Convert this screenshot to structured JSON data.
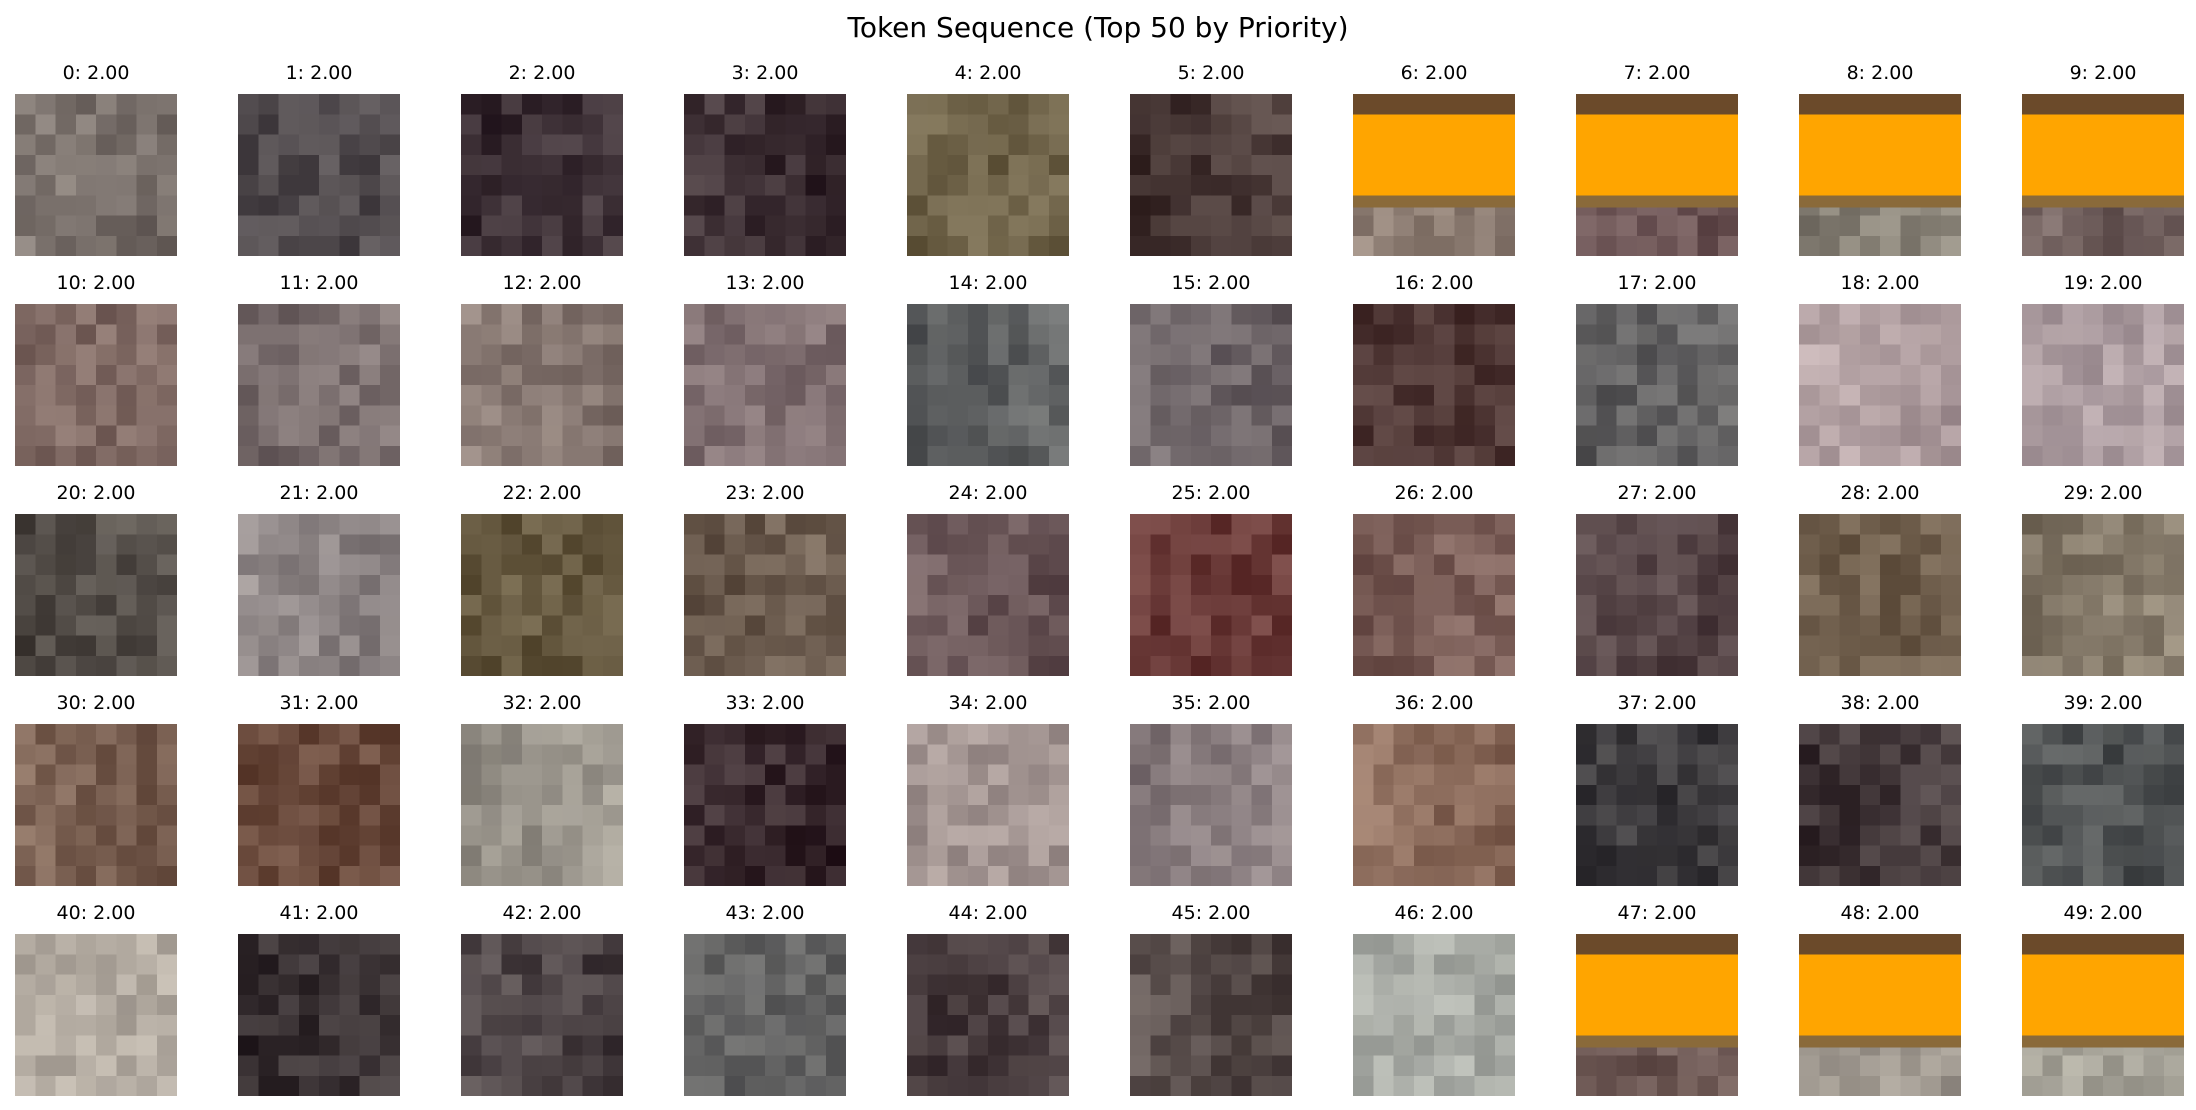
{
  "figure": {
    "title": "Token Sequence (Top 50 by Priority)"
  },
  "colors": {
    "highlight": "#FFA500"
  },
  "tokens": [
    {
      "label": "0: 2.00",
      "tone": "#7a716c",
      "banner": false
    },
    {
      "label": "1: 2.00",
      "tone": "#524c4f",
      "banner": false
    },
    {
      "label": "2: 2.00",
      "tone": "#3d3036",
      "banner": false
    },
    {
      "label": "3: 2.00",
      "tone": "#3d2f34",
      "banner": false
    },
    {
      "label": "4: 2.00",
      "tone": "#6e6248",
      "banner": false
    },
    {
      "label": "5: 2.00",
      "tone": "#4a3a38",
      "banner": false
    },
    {
      "label": "6: 2.00",
      "tone": "#8a7a70",
      "banner": true
    },
    {
      "label": "7: 2.00",
      "tone": "#6d5556",
      "banner": true
    },
    {
      "label": "8: 2.00",
      "tone": "#8a8479",
      "banner": true
    },
    {
      "label": "9: 2.00",
      "tone": "#6e5d5b",
      "banner": true
    },
    {
      "label": "10: 2.00",
      "tone": "#806a64",
      "banner": false
    },
    {
      "label": "11: 2.00",
      "tone": "#7a6e6e",
      "banner": false
    },
    {
      "label": "12: 2.00",
      "tone": "#857670",
      "banner": false
    },
    {
      "label": "13: 2.00",
      "tone": "#806f71",
      "banner": false
    },
    {
      "label": "14: 2.00",
      "tone": "#5d5f60",
      "banner": false
    },
    {
      "label": "15: 2.00",
      "tone": "#6f6669",
      "banner": false
    },
    {
      "label": "16: 2.00",
      "tone": "#4e3634",
      "banner": false
    },
    {
      "label": "17: 2.00",
      "tone": "#636263",
      "banner": false
    },
    {
      "label": "18: 2.00",
      "tone": "#b09ea0",
      "banner": false
    },
    {
      "label": "19: 2.00",
      "tone": "#ae9ea2",
      "banner": false
    },
    {
      "label": "20: 2.00",
      "tone": "#534d48",
      "banner": false
    },
    {
      "label": "21: 2.00",
      "tone": "#8d8585",
      "banner": false
    },
    {
      "label": "22: 2.00",
      "tone": "#65583f",
      "banner": false
    },
    {
      "label": "23: 2.00",
      "tone": "#6c5c4f",
      "banner": false
    },
    {
      "label": "24: 2.00",
      "tone": "#6a5658",
      "banner": false
    },
    {
      "label": "25: 2.00",
      "tone": "#6a3a38",
      "banner": false
    },
    {
      "label": "26: 2.00",
      "tone": "#7a5d57",
      "banner": false
    },
    {
      "label": "27: 2.00",
      "tone": "#574648",
      "banner": false
    },
    {
      "label": "28: 2.00",
      "tone": "#705f4d",
      "banner": false
    },
    {
      "label": "29: 2.00",
      "tone": "#857a6a",
      "banner": false
    },
    {
      "label": "30: 2.00",
      "tone": "#7a6052",
      "banner": false
    },
    {
      "label": "31: 2.00",
      "tone": "#6a4a3c",
      "banner": false
    },
    {
      "label": "32: 2.00",
      "tone": "#9a958c",
      "banner": false
    },
    {
      "label": "33: 2.00",
      "tone": "#3a2a2f",
      "banner": false
    },
    {
      "label": "34: 2.00",
      "tone": "#a39592",
      "banner": false
    },
    {
      "label": "35: 2.00",
      "tone": "#887c7e",
      "banner": false
    },
    {
      "label": "36: 2.00",
      "tone": "#8c6c5c",
      "banner": false
    },
    {
      "label": "37: 2.00",
      "tone": "#3c3a3d",
      "banner": false
    },
    {
      "label": "38: 2.00",
      "tone": "#453a3c",
      "banner": false
    },
    {
      "label": "39: 2.00",
      "tone": "#4f5253",
      "banner": false
    },
    {
      "label": "40: 2.00",
      "tone": "#b4aca2",
      "banner": false
    },
    {
      "label": "41: 2.00",
      "tone": "#3c3436",
      "banner": false
    },
    {
      "label": "42: 2.00",
      "tone": "#4d4446",
      "banner": false
    },
    {
      "label": "43: 2.00",
      "tone": "#646464",
      "banner": false
    },
    {
      "label": "44: 2.00",
      "tone": "#4a3e40",
      "banner": false
    },
    {
      "label": "45: 2.00",
      "tone": "#574c4a",
      "banner": false
    },
    {
      "label": "46: 2.00",
      "tone": "#a9aca6",
      "banner": false
    },
    {
      "label": "47: 2.00",
      "tone": "#6f5a56",
      "banner": true
    },
    {
      "label": "48: 2.00",
      "tone": "#a39c93",
      "banner": true
    },
    {
      "label": "49: 2.00",
      "tone": "#aaa79c",
      "banner": true
    }
  ]
}
